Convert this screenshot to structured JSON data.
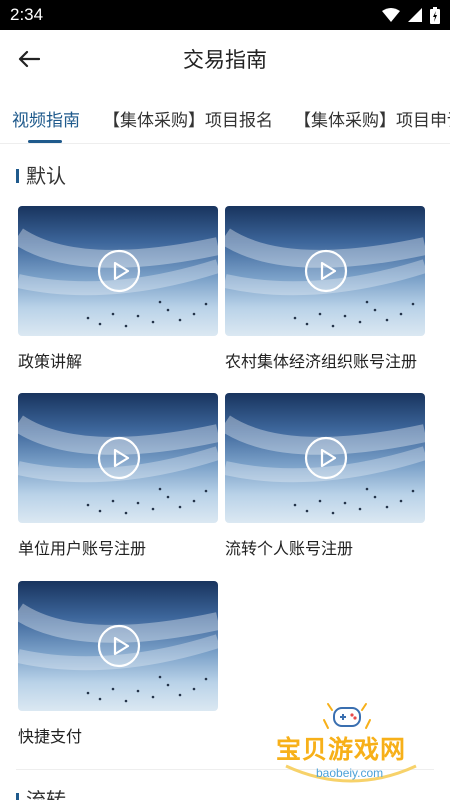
{
  "status_bar": {
    "time": "2:34"
  },
  "header": {
    "title": "交易指南"
  },
  "tabs": [
    {
      "label": "视频指南",
      "active": true
    },
    {
      "label": "【集体采购】项目报名",
      "active": false
    },
    {
      "label": "【集体采购】项目申请",
      "active": false
    }
  ],
  "sections": [
    {
      "title": "默认",
      "videos": [
        {
          "label": "政策讲解"
        },
        {
          "label": "农村集体经济组织账号注册"
        },
        {
          "label": "单位用户账号注册"
        },
        {
          "label": "流转个人账号注册"
        },
        {
          "label": "快捷支付"
        }
      ]
    },
    {
      "title": "流转"
    }
  ],
  "watermark": {
    "text": "宝贝游戏网",
    "url": "baobeiy.com"
  },
  "colors": {
    "accent": "#1f5a8c",
    "status_bar": "#000000",
    "watermark": "#f7b019"
  }
}
